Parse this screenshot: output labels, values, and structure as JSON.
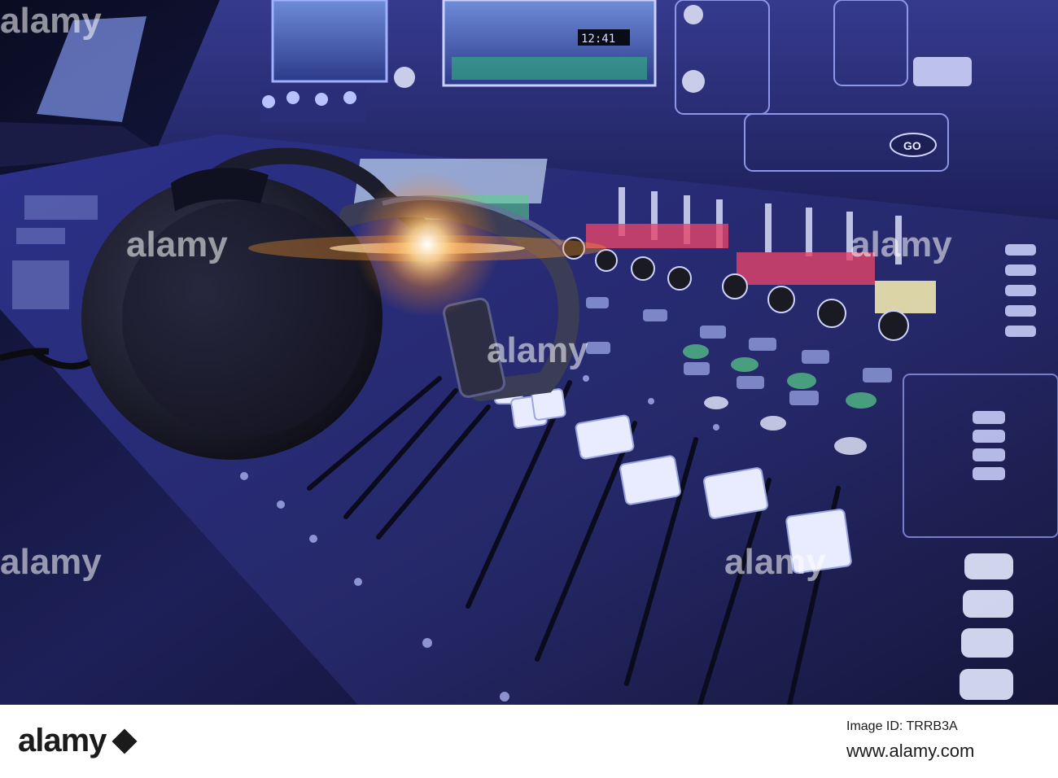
{
  "scene": {
    "clock_display": "12:41",
    "go_button_label": "GO"
  },
  "watermark": {
    "text": "alamy"
  },
  "footer": {
    "logo": "alamy",
    "image_id": "Image ID: TRRB3A",
    "url": "www.alamy.com"
  },
  "colors": {
    "console_blue": "#2a2f7a",
    "flare_orange": "#ff9a2a",
    "mute_red": "#e5436a",
    "meter_green": "#59d08a"
  }
}
